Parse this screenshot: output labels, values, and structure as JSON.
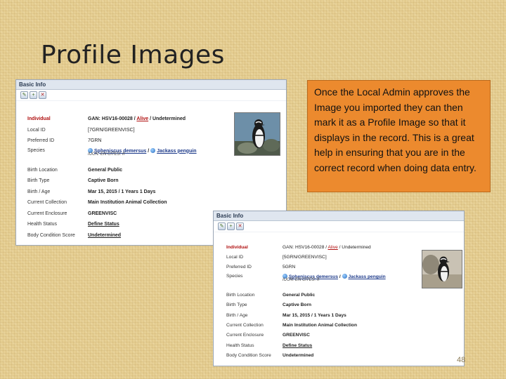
{
  "slide": {
    "title": "Profile Images",
    "callout": "Once the Local Admin approves the Image you imported they can then mark it as a Profile Image so that it displays in the record. This is a great help in ensuring that you are in the correct record when doing data entry.",
    "number": "48"
  },
  "panel_a": {
    "header": "Basic Info",
    "individual_label": "Individual",
    "gan": "GAN: HSV16-00028 / ",
    "alive": "Alive",
    "status_rest": " / Undetermined",
    "rows": [
      {
        "label": "Local ID",
        "value": "[7GRN/GREENVISC]"
      },
      {
        "label": "Preferred ID",
        "value": "7GRN"
      },
      {
        "label": "Species",
        "species": "Spheniscus demersus",
        "sep": " / ",
        "common": "Jackass penguin",
        "sub": "IUCN: EN   CITES: II"
      },
      {
        "label": "Birth Location",
        "value": "General Public"
      },
      {
        "label": "Birth Type",
        "value": "Captive Born"
      },
      {
        "label": "Birth / Age",
        "value": "Mar 15, 2015 / 1 Years 1 Days"
      },
      {
        "label": "Current Collection",
        "value": "Main Institution Animal Collection"
      },
      {
        "label": "Current Enclosure",
        "value": "GREENVISC"
      },
      {
        "label": "Health Status",
        "value": "Define Status"
      },
      {
        "label": "Body Condition Score",
        "value": "Undetermined"
      }
    ]
  },
  "panel_b": {
    "header": "Basic Info",
    "individual_label": "Individual",
    "gan": "GAN: HSV16-00028 / ",
    "alive": "Alive",
    "status_rest": " / Undetermined",
    "rows": [
      {
        "label": "Local ID",
        "value": "[5GRN/GREENVISC]"
      },
      {
        "label": "Preferred ID",
        "value": "5GRN"
      },
      {
        "label": "Species",
        "species": "Spheniscus demersus",
        "sep": " / ",
        "common": "Jackass penguin",
        "sub": "IUCN: EN   CITES: II"
      },
      {
        "label": "Birth Location",
        "value": "General Public"
      },
      {
        "label": "Birth Type",
        "value": "Captive Born"
      },
      {
        "label": "Birth / Age",
        "value": "Mar 15, 2015 / 1 Years 1 Days"
      },
      {
        "label": "Current Collection",
        "value": "Main Institution Animal Collection"
      },
      {
        "label": "Current Enclosure",
        "value": "GREENVISC"
      },
      {
        "label": "Health Status",
        "value": "Define Status"
      },
      {
        "label": "Body Condition Score",
        "value": "Undetermined"
      }
    ]
  },
  "icons": {
    "toolbar": [
      "edit-icon",
      "add-icon",
      "delete-icon"
    ],
    "species": "globe-icon",
    "photo": "penguin-photo"
  },
  "colors": {
    "callout_bg": "#ec8a2e",
    "status_red": "#b01010",
    "link_blue": "#1d3a8a"
  }
}
